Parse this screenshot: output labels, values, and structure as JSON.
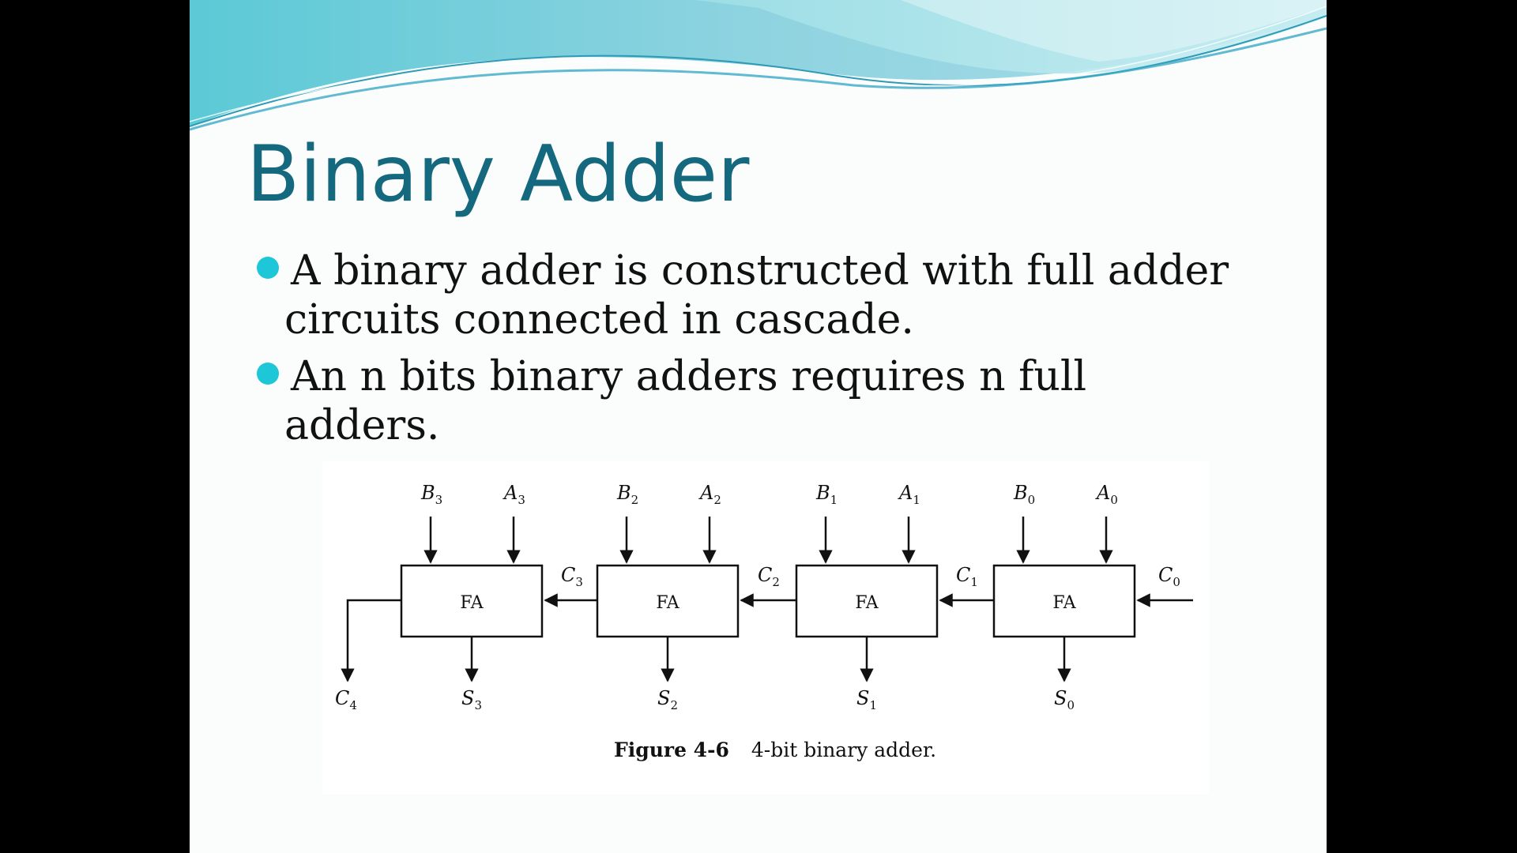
{
  "slide": {
    "title": "Binary Adder",
    "bullets": [
      {
        "line1": "A binary adder is constructed with full adder",
        "line2": "circuits connected in cascade."
      },
      {
        "line1": "An n bits binary adders requires n full",
        "line2": "adders."
      }
    ],
    "colors": {
      "title": "#14697f",
      "bullet": "#1dc7d8",
      "background": "#fbfcfc",
      "wave_light": "#9fdbe4",
      "wave_dark": "#3aa9c6"
    }
  },
  "figure": {
    "block_label": "FA",
    "stages": [
      {
        "B": "B",
        "B_sub": "3",
        "A": "A",
        "A_sub": "3",
        "S": "S",
        "S_sub": "3",
        "Cin": "C",
        "Cin_sub": "3"
      },
      {
        "B": "B",
        "B_sub": "2",
        "A": "A",
        "A_sub": "2",
        "S": "S",
        "S_sub": "2",
        "Cin": "C",
        "Cin_sub": "2"
      },
      {
        "B": "B",
        "B_sub": "1",
        "A": "A",
        "A_sub": "1",
        "S": "S",
        "S_sub": "1",
        "Cin": "C",
        "Cin_sub": "1"
      },
      {
        "B": "B",
        "B_sub": "0",
        "A": "A",
        "A_sub": "0",
        "S": "S",
        "S_sub": "0",
        "Cin": "C",
        "Cin_sub": "0"
      }
    ],
    "carry_out": {
      "label": "C",
      "sub": "4"
    },
    "caption_bold": "Figure 4-6",
    "caption_text": "4-bit binary adder."
  }
}
